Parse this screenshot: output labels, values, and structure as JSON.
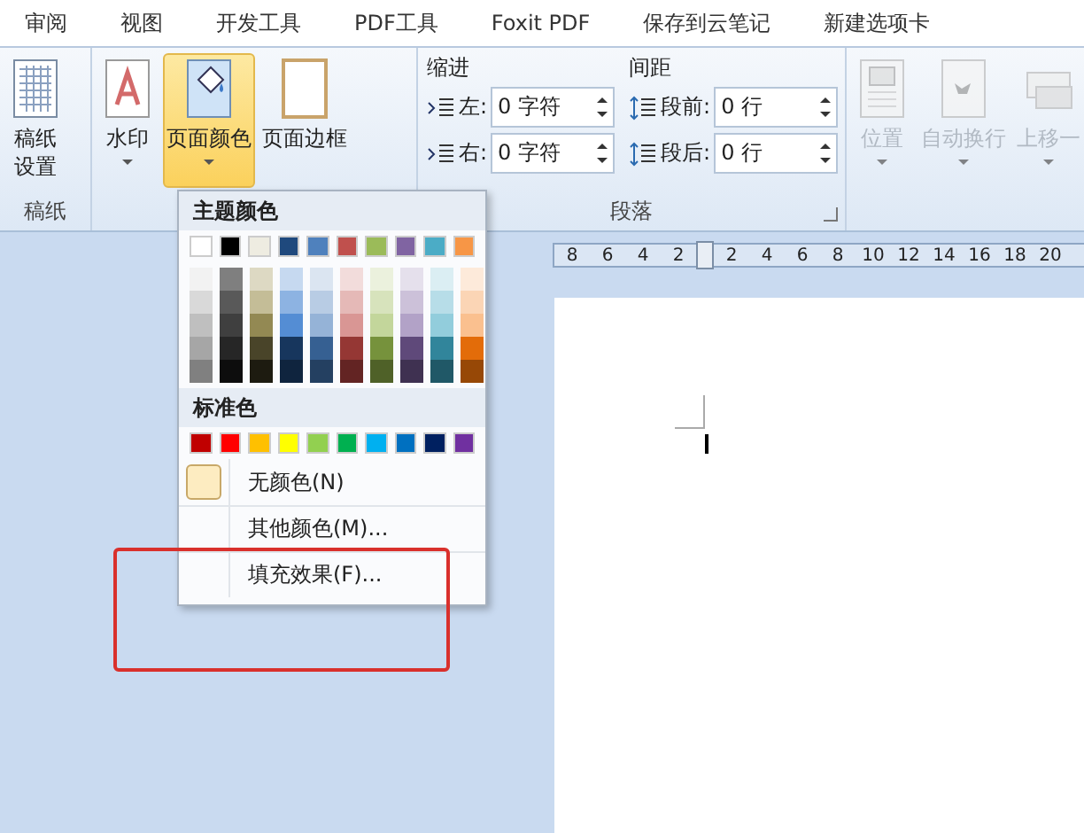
{
  "tabs": [
    {
      "label": "审阅",
      "selected": false
    },
    {
      "label": "视图",
      "selected": false
    },
    {
      "label": "开发工具",
      "selected": false
    },
    {
      "label": "PDF工具",
      "selected": false
    },
    {
      "label": "Foxit PDF",
      "selected": false
    },
    {
      "label": "保存到云笔记",
      "selected": false
    },
    {
      "label": "新建选项卡",
      "selected": false
    }
  ],
  "ribbon": {
    "groups": [
      {
        "label": "稿纸",
        "buttons": [
          {
            "kind": "paper",
            "label": "稿纸设置",
            "selected": false,
            "disabled": false,
            "dropdown": false
          }
        ]
      },
      {
        "buttons": [
          {
            "kind": "watermark",
            "label": "水印",
            "selected": false,
            "disabled": false,
            "dropdown": true
          },
          {
            "kind": "page-color",
            "label": "页面颜色",
            "selected": true,
            "disabled": false,
            "dropdown": true
          },
          {
            "kind": "page-border",
            "label": "页面边框",
            "selected": false,
            "disabled": false,
            "dropdown": false
          }
        ]
      },
      {
        "label": "段落",
        "indent": {
          "title": "缩进",
          "fields": [
            {
              "label": "左:",
              "value": "0 字符"
            },
            {
              "label": "右:",
              "value": "0 字符"
            }
          ]
        },
        "spacing": {
          "title": "间距",
          "fields": [
            {
              "label": "段前:",
              "value": "0 行"
            },
            {
              "label": "段后:",
              "value": "0 行"
            }
          ]
        }
      },
      {
        "buttons": [
          {
            "kind": "position",
            "label": "位置",
            "selected": false,
            "disabled": true,
            "dropdown": true
          },
          {
            "kind": "wrap",
            "label": "自动换行",
            "selected": false,
            "disabled": true,
            "dropdown": true
          },
          {
            "kind": "forward",
            "label": "上移一",
            "selected": false,
            "disabled": true,
            "dropdown": true
          }
        ]
      }
    ]
  },
  "ruler": {
    "labels": [
      "8",
      "6",
      "4",
      "2",
      "2",
      "4",
      "6",
      "8",
      "10",
      "12",
      "14",
      "16",
      "18",
      "20"
    ]
  },
  "color_menu": {
    "theme_title": "主题颜色",
    "theme_colors": [
      {
        "color": "#ffffff",
        "shades": [
          {
            "color": "#f2f2f2"
          },
          {
            "color": "#d9d9d9"
          },
          {
            "color": "#bfbfbf"
          },
          {
            "color": "#a6a6a6"
          },
          {
            "color": "#808080"
          }
        ]
      },
      {
        "color": "#000000",
        "shades": [
          {
            "color": "#7f7f7f"
          },
          {
            "color": "#595959"
          },
          {
            "color": "#3f3f3f"
          },
          {
            "color": "#262626"
          },
          {
            "color": "#0d0d0d"
          }
        ]
      },
      {
        "color": "#eeece1",
        "shades": [
          {
            "color": "#ddd9c3"
          },
          {
            "color": "#c4bd97"
          },
          {
            "color": "#938953"
          },
          {
            "color": "#494429"
          },
          {
            "color": "#1d1b10"
          }
        ]
      },
      {
        "color": "#1f497d",
        "shades": [
          {
            "color": "#c6d9f0"
          },
          {
            "color": "#8db3e2"
          },
          {
            "color": "#548dd4"
          },
          {
            "color": "#17365d"
          },
          {
            "color": "#0f243e"
          }
        ]
      },
      {
        "color": "#4f81bd",
        "shades": [
          {
            "color": "#dbe5f1"
          },
          {
            "color": "#b8cce4"
          },
          {
            "color": "#95b3d7"
          },
          {
            "color": "#366092"
          },
          {
            "color": "#244061"
          }
        ]
      },
      {
        "color": "#c0504d",
        "shades": [
          {
            "color": "#f2dcdb"
          },
          {
            "color": "#e5b9b7"
          },
          {
            "color": "#d99694"
          },
          {
            "color": "#953734"
          },
          {
            "color": "#632423"
          }
        ]
      },
      {
        "color": "#9bbb59",
        "shades": [
          {
            "color": "#ebf1dd"
          },
          {
            "color": "#d7e3bc"
          },
          {
            "color": "#c3d69b"
          },
          {
            "color": "#76923c"
          },
          {
            "color": "#4f6128"
          }
        ]
      },
      {
        "color": "#8064a2",
        "shades": [
          {
            "color": "#e5e0ec"
          },
          {
            "color": "#ccc1d9"
          },
          {
            "color": "#b2a2c7"
          },
          {
            "color": "#5f497a"
          },
          {
            "color": "#3f3151"
          }
        ]
      },
      {
        "color": "#4bacc6",
        "shades": [
          {
            "color": "#dbeef3"
          },
          {
            "color": "#b7dde8"
          },
          {
            "color": "#92cddc"
          },
          {
            "color": "#31859b"
          },
          {
            "color": "#205867"
          }
        ]
      },
      {
        "color": "#f79646",
        "shades": [
          {
            "color": "#fdeada"
          },
          {
            "color": "#fbd5b5"
          },
          {
            "color": "#fac08f"
          },
          {
            "color": "#e36c09"
          },
          {
            "color": "#974806"
          }
        ]
      }
    ],
    "standard_title": "标准色",
    "standard_colors": [
      {
        "color": "#c00000"
      },
      {
        "color": "#ff0000"
      },
      {
        "color": "#ffc000"
      },
      {
        "color": "#ffff00"
      },
      {
        "color": "#92d050"
      },
      {
        "color": "#00b050"
      },
      {
        "color": "#00b0f0"
      },
      {
        "color": "#0070c0"
      },
      {
        "color": "#002060"
      },
      {
        "color": "#7030a0"
      }
    ],
    "items": [
      {
        "kind": "no-color",
        "label": "无颜色(N)"
      },
      {
        "kind": "plain",
        "label": "其他颜色(M)..."
      },
      {
        "kind": "plain",
        "label": "填充效果(F)..."
      }
    ]
  }
}
